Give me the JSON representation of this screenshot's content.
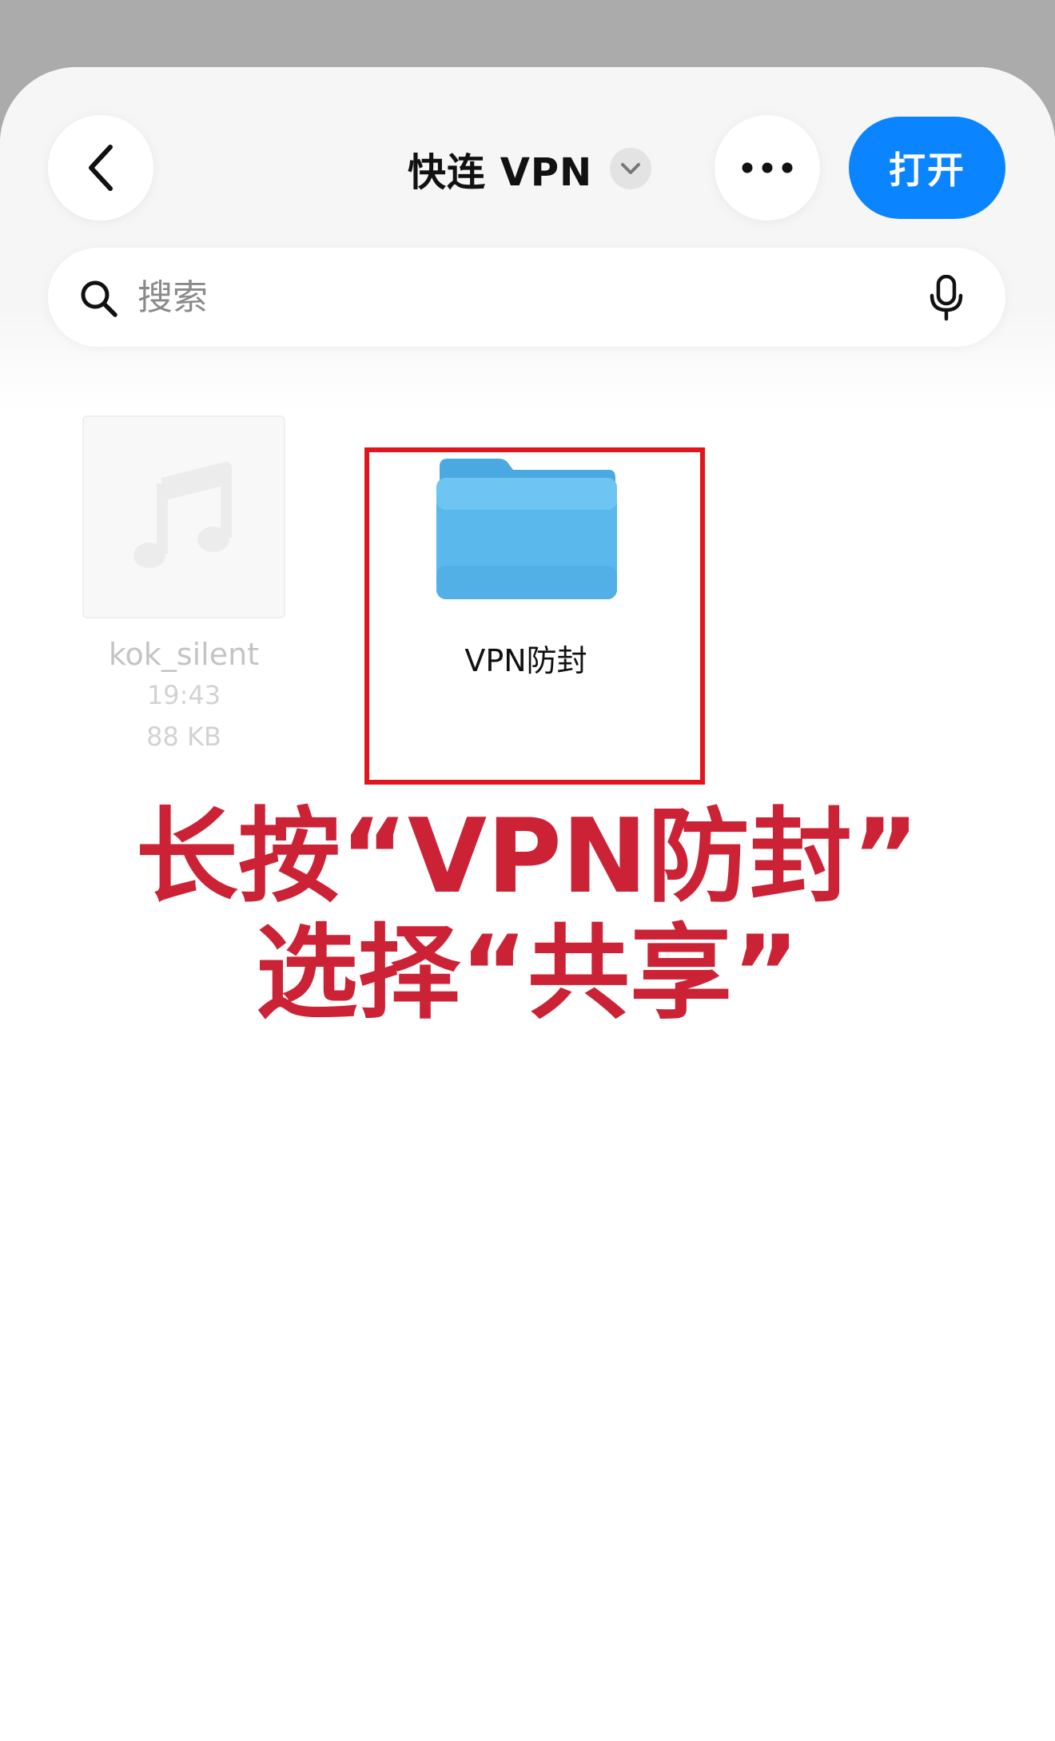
{
  "header": {
    "title": "快连 VPN",
    "open_label": "打开"
  },
  "search": {
    "placeholder": "搜索"
  },
  "files": [
    {
      "name": "kok_silent",
      "time": "19:43",
      "size": "88 KB",
      "icon": "music-note-icon"
    },
    {
      "name": "VPN防封",
      "icon": "folder-icon"
    }
  ],
  "annotation": {
    "line1": "长按“VPN防封”",
    "line2": "选择“共享”"
  },
  "colors": {
    "accent": "#0a84ff",
    "folder": "#5ab8ec",
    "highlight_border": "#e3141c",
    "annotation_text": "#cc2236"
  }
}
